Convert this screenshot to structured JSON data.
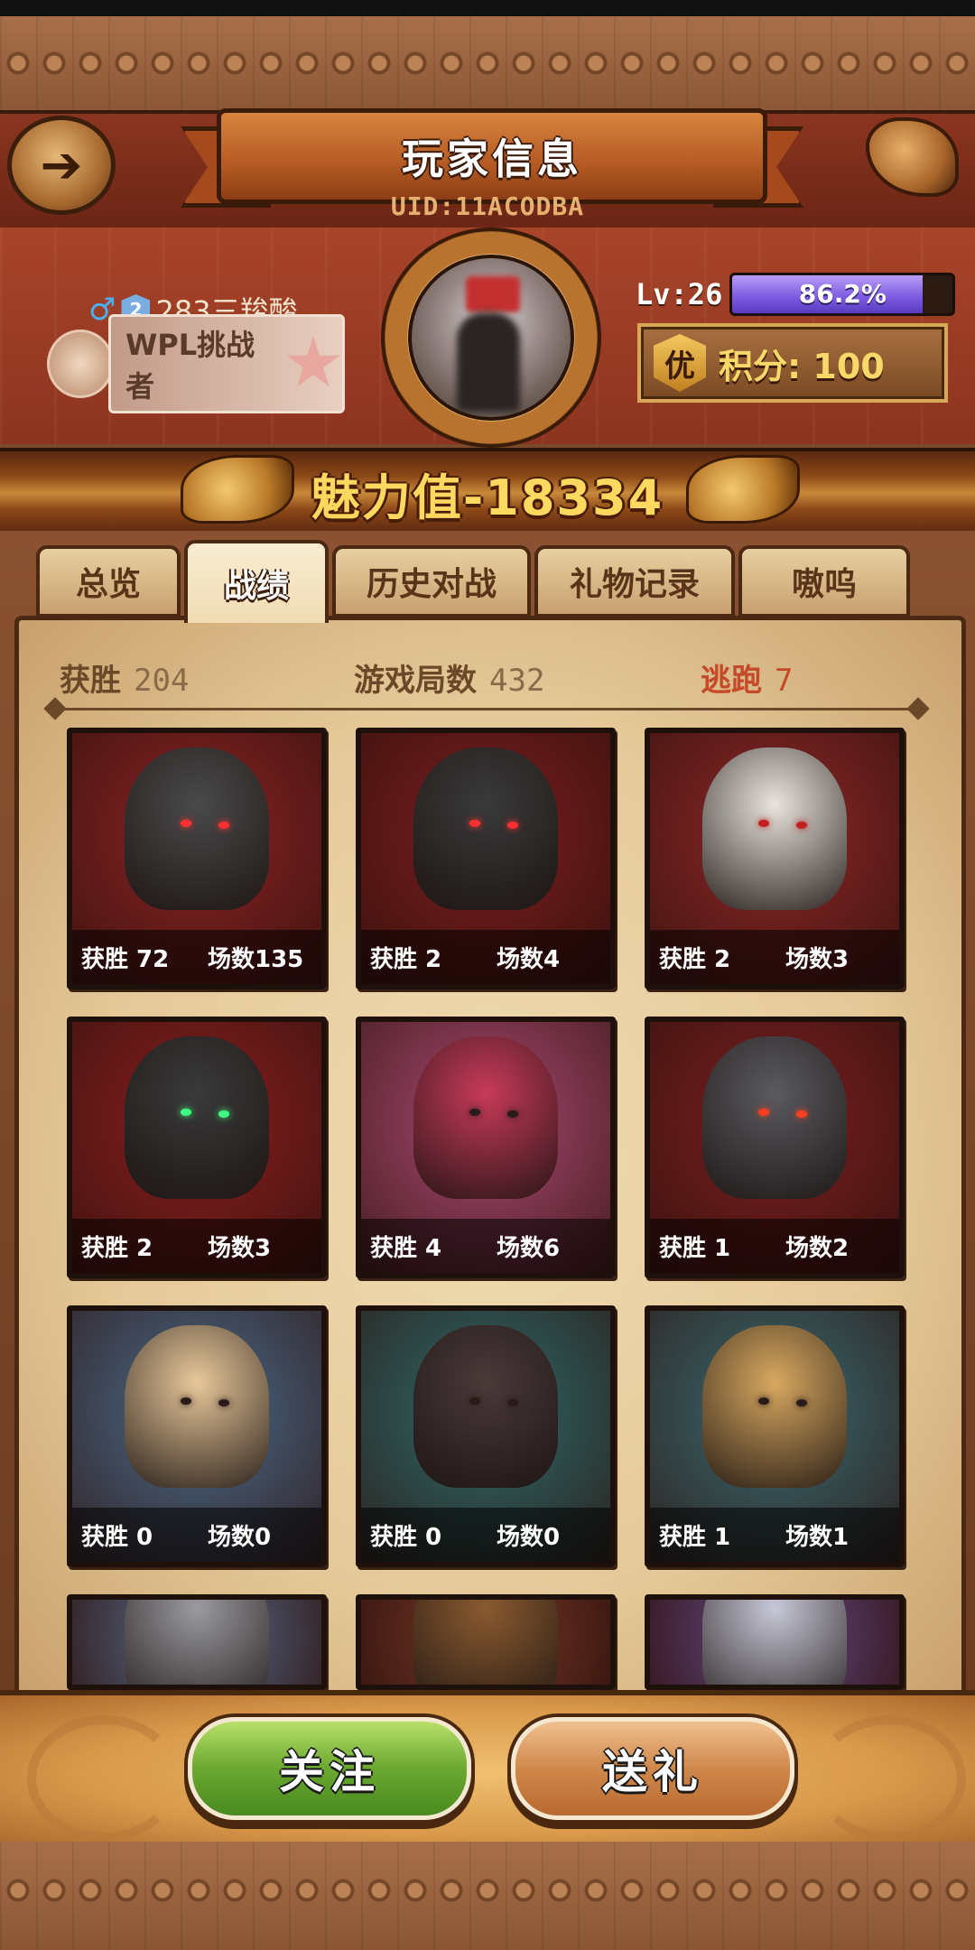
{
  "header": {
    "back_icon": "back-arrow-icon",
    "title": "玩家信息",
    "uid": "UID:11ACODBA"
  },
  "profile": {
    "gender_symbol": "♂",
    "rank_badge": "2",
    "username": "283三羧酸",
    "title_badge": "WPL挑战者",
    "level_label": "Lv:26",
    "xp_percent_text": "86.2%",
    "xp_fraction": 0.862,
    "score_icon_text": "优",
    "score_text": "积分: 100"
  },
  "charm": {
    "text": "魅力值-18334"
  },
  "tabs": [
    {
      "label": "总览",
      "active": false
    },
    {
      "label": "战绩",
      "active": true
    },
    {
      "label": "历史对战",
      "active": false
    },
    {
      "label": "礼物记录",
      "active": false
    },
    {
      "label": "嗷呜",
      "active": false
    }
  ],
  "stats": {
    "wins_label": "获胜",
    "wins_value": "204",
    "games_label": "游戏局数",
    "games_value": "432",
    "escape_label": "逃跑",
    "escape_value": "7"
  },
  "roles": [
    {
      "name": "dark-werewolf",
      "wins": "获胜 72",
      "games": "场数135",
      "bg": "#8a2424",
      "fig": "#4a4a4a",
      "eye": "#ff3030"
    },
    {
      "name": "shadow-werewolf",
      "wins": "获胜 2",
      "games": "场数4",
      "bg": "#7a1e1e",
      "fig": "#3a3a3a",
      "eye": "#ff3030"
    },
    {
      "name": "white-werewolf",
      "wins": "获胜 2",
      "games": "场数3",
      "bg": "#8c2828",
      "fig": "#e8e4dc",
      "eye": "#c02020"
    },
    {
      "name": "hooded-reaper",
      "wins": "获胜 2",
      "games": "场数3",
      "bg": "#8a2020",
      "fig": "#3a3a3a",
      "eye": "#40ff80"
    },
    {
      "name": "pink-haired-witch",
      "wins": "获胜 4",
      "games": "场数6",
      "bg": "#a84a70",
      "fig": "#c83a5a",
      "eye": "#2a1a1a"
    },
    {
      "name": "gargoyle-demon",
      "wins": "获胜 1",
      "games": "场数2",
      "bg": "#7a2020",
      "fig": "#5a5a60",
      "eye": "#ff4020"
    },
    {
      "name": "winged-cupid",
      "wins": "获胜 0",
      "games": "场数0",
      "bg": "#4a6a88",
      "fig": "#e8c89a",
      "eye": "#2a1a1a"
    },
    {
      "name": "top-hat-gentleman",
      "wins": "获胜 0",
      "games": "场数0",
      "bg": "#2e6a6a",
      "fig": "#4a3a3a",
      "eye": "#2a1a1a"
    },
    {
      "name": "masked-noble",
      "wins": "获胜 1",
      "games": "场数1",
      "bg": "#3a6a70",
      "fig": "#d8a860",
      "eye": "#2a1a1a"
    },
    {
      "name": "armored-knight",
      "wins": "",
      "games": "",
      "bg": "#5a7090",
      "fig": "#9a9aa0",
      "eye": "#2a1a1a"
    },
    {
      "name": "hunter",
      "wins": "",
      "games": "",
      "bg": "#7a3a2a",
      "fig": "#8a5a30",
      "eye": "#2a1a1a"
    },
    {
      "name": "star-mage",
      "wins": "",
      "games": "",
      "bg": "#6a4a8a",
      "fig": "#c8c8d8",
      "eye": "#2a1a1a"
    }
  ],
  "buttons": {
    "follow": "关注",
    "gift": "送礼"
  }
}
